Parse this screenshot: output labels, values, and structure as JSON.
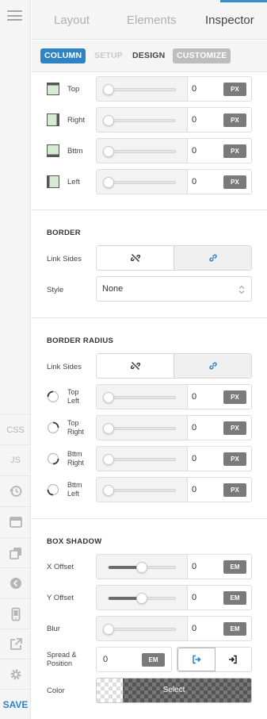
{
  "tabs": {
    "layout": "Layout",
    "elements": "Elements",
    "inspector": "Inspector"
  },
  "subtabs": {
    "column": "COLUMN",
    "setup": "SETUP",
    "design": "DESIGN",
    "customize": "CUSTOMIZE"
  },
  "rail": {
    "css": "CSS",
    "js": "JS",
    "save": "SAVE"
  },
  "padding": {
    "sides": [
      {
        "label": "Top",
        "value": "0",
        "unit": "PX"
      },
      {
        "label": "Right",
        "value": "0",
        "unit": "PX"
      },
      {
        "label": "Bttm",
        "value": "0",
        "unit": "PX"
      },
      {
        "label": "Left",
        "value": "0",
        "unit": "PX"
      }
    ]
  },
  "border": {
    "title": "BORDER",
    "link_label": "Link Sides",
    "style_label": "Style",
    "style_value": "None"
  },
  "border_radius": {
    "title": "BORDER RADIUS",
    "link_label": "Link Sides",
    "corners": [
      {
        "label1": "Top",
        "label2": "Left",
        "value": "0",
        "unit": "PX"
      },
      {
        "label1": "Top",
        "label2": "Right",
        "value": "0",
        "unit": "PX"
      },
      {
        "label1": "Bttm",
        "label2": "Right",
        "value": "0",
        "unit": "PX"
      },
      {
        "label1": "Bttm",
        "label2": "Left",
        "value": "0",
        "unit": "PX"
      }
    ]
  },
  "box_shadow": {
    "title": "BOX SHADOW",
    "x_label": "X Offset",
    "x_value": "0",
    "x_unit": "EM",
    "x_slider": 0.5,
    "y_label": "Y Offset",
    "y_value": "0",
    "y_unit": "EM",
    "y_slider": 0.5,
    "blur_label": "Blur",
    "blur_value": "0",
    "blur_unit": "EM",
    "blur_slider": 0,
    "spread_label1": "Spread &",
    "spread_label2": "Position",
    "spread_value": "0",
    "spread_unit": "EM",
    "color_label": "Color",
    "color_select": "Select"
  },
  "colors": {
    "accent": "#2e83c4",
    "unit_badge": "#7a7a7a"
  }
}
